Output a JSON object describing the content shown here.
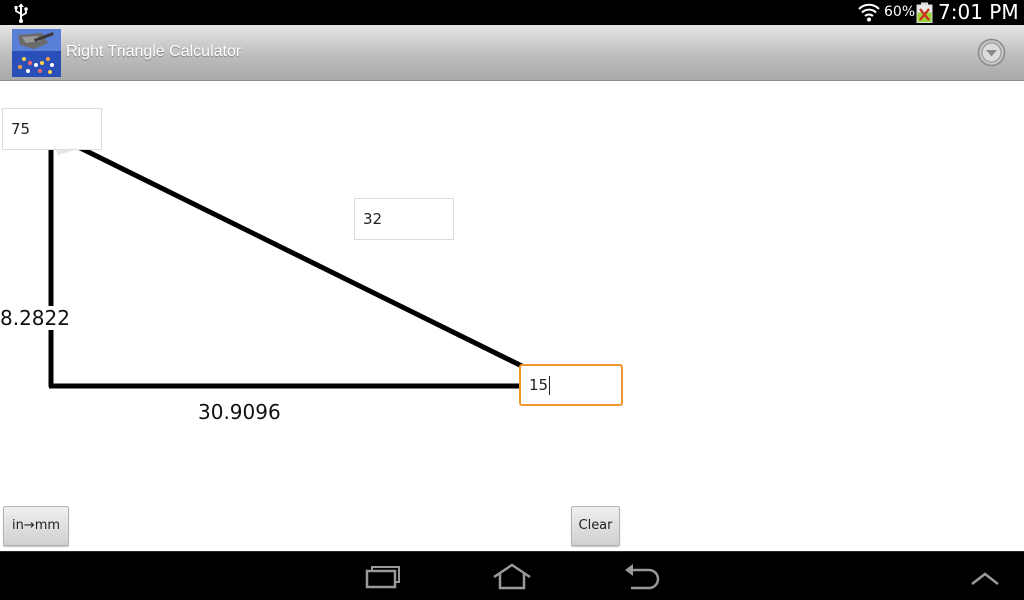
{
  "status_bar": {
    "battery_percent": "60%",
    "time": "7:01 PM",
    "icons": [
      "usb-icon",
      "wifi-icon",
      "battery-charging-icon"
    ]
  },
  "action_bar": {
    "title": "Right Triangle Calculator",
    "overflow_icon": "overflow-menu-icon"
  },
  "triangle": {
    "angle_top_field": "75",
    "hypotenuse_field": "32",
    "angle_right_field": "15",
    "vertical_side_label": "8.2822",
    "horizontal_side_label": "30.9096",
    "line_color": "#000000",
    "focus_color": "#f0962e"
  },
  "buttons": {
    "convert_label": "in→mm",
    "clear_label": "Clear"
  },
  "nav_bar": {
    "icons": [
      "recent-apps-icon",
      "home-icon",
      "back-icon",
      "menu-up-icon"
    ]
  }
}
